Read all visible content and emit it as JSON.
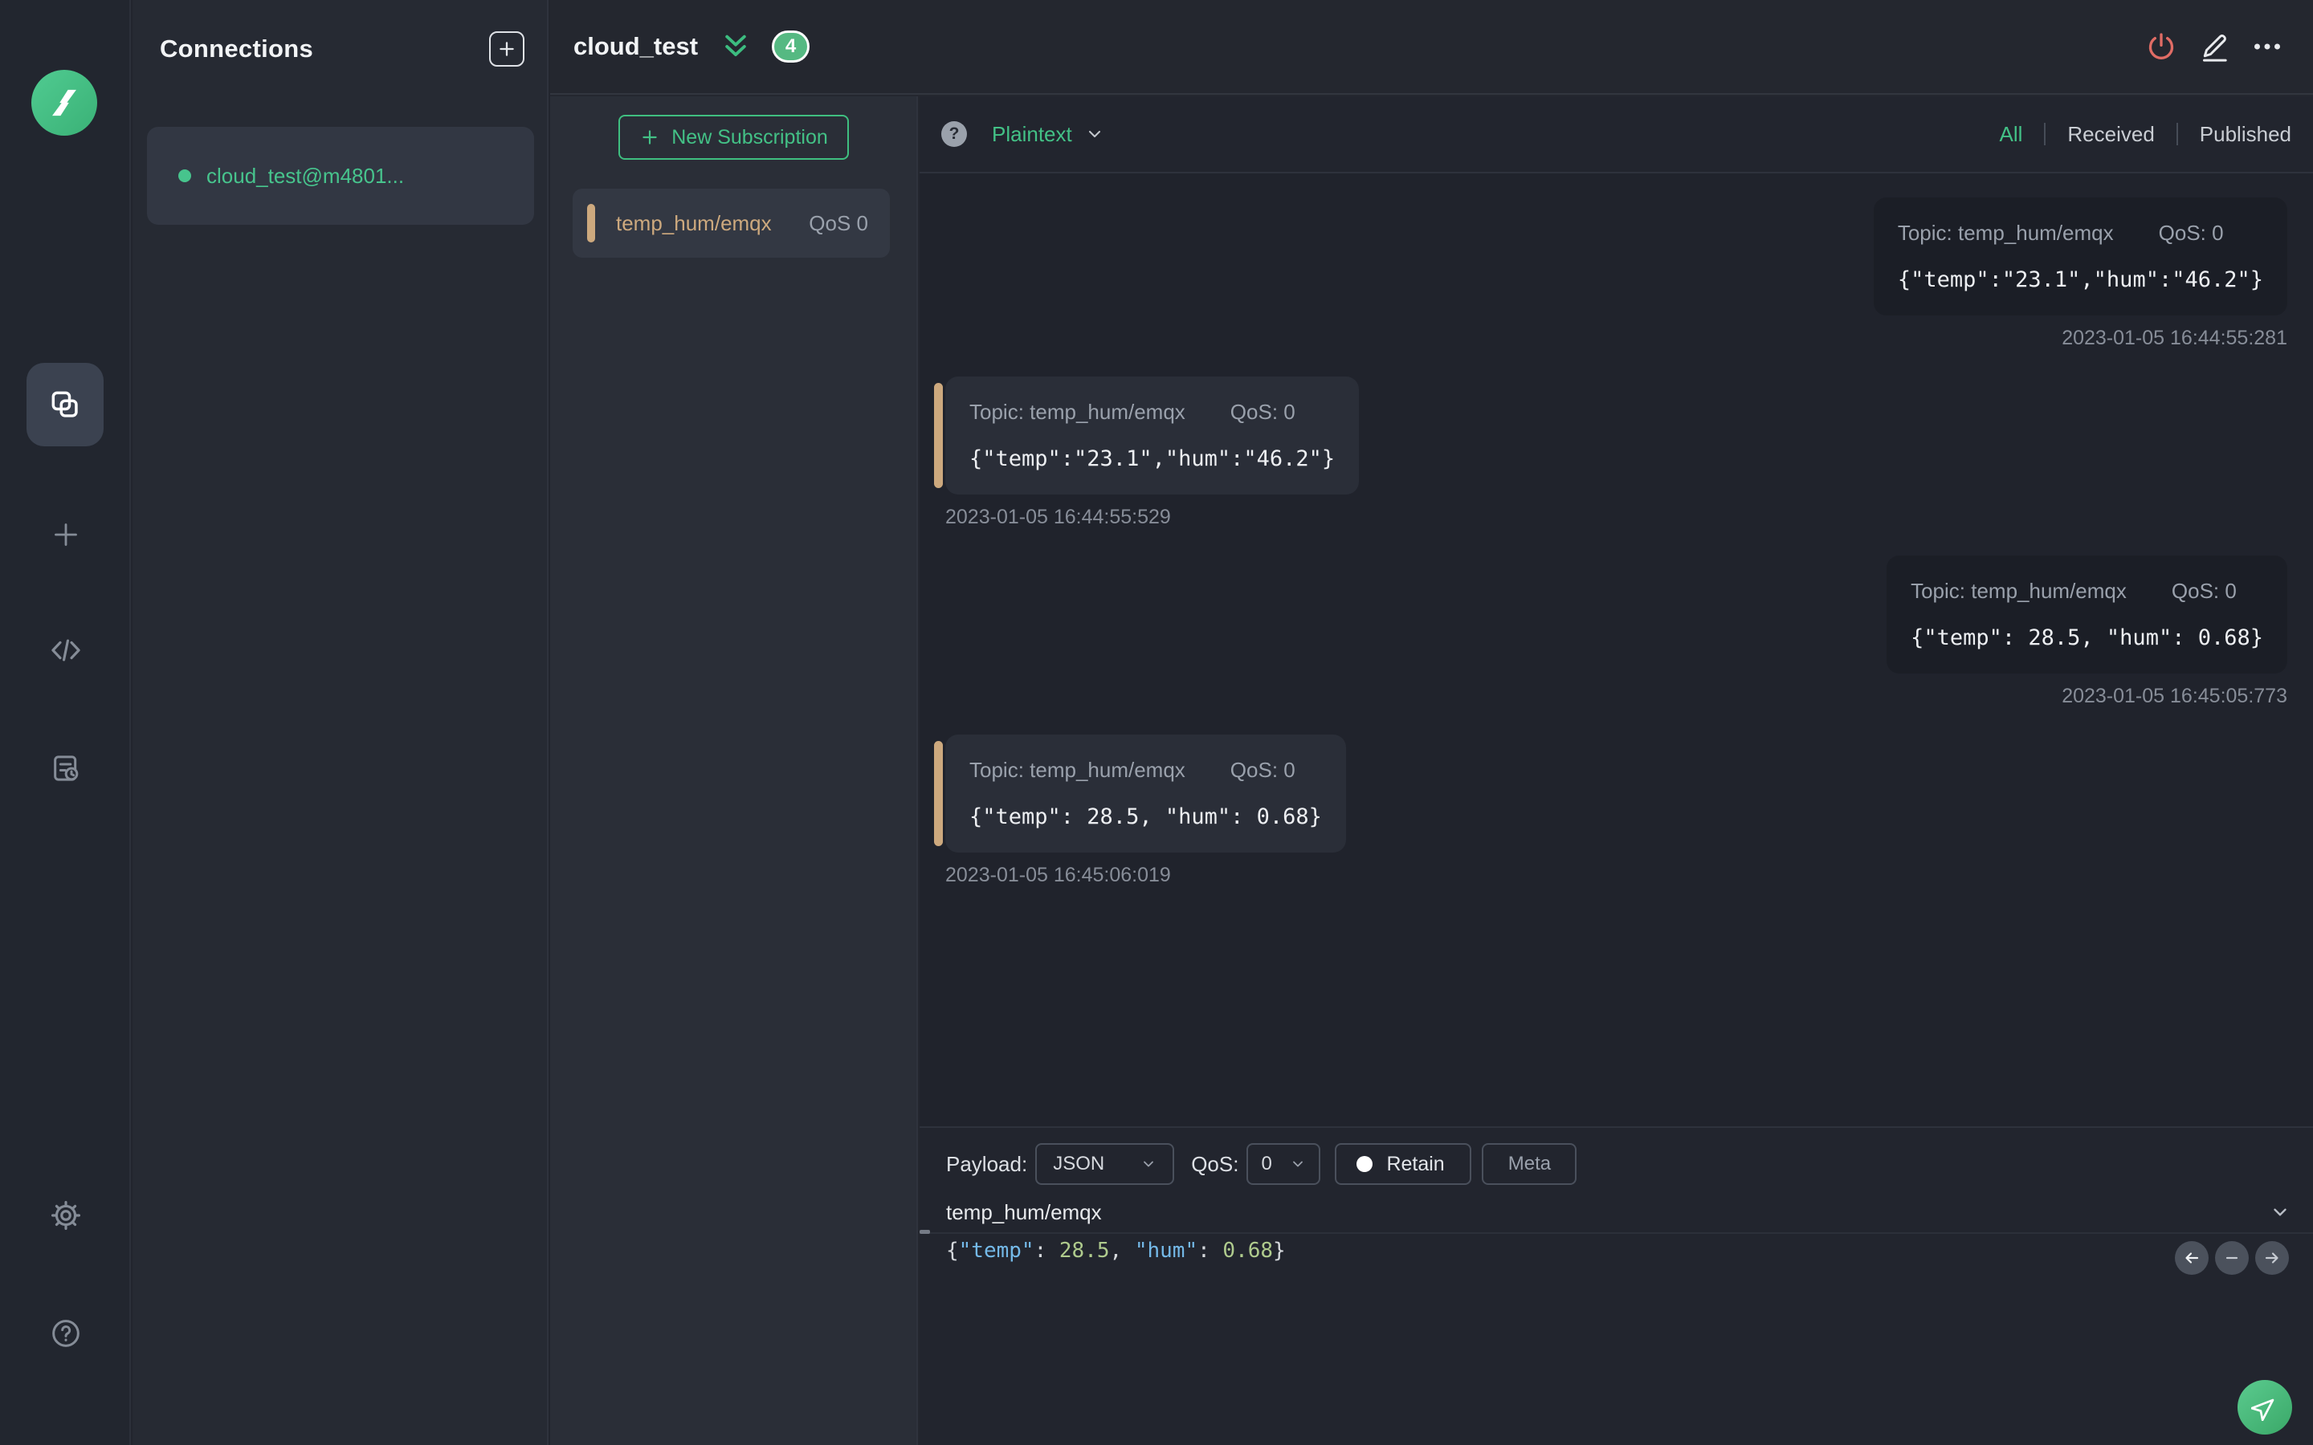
{
  "colors": {
    "accent_green": "#42c183",
    "tan_accent": "#cda97e",
    "danger_red": "#e06c65"
  },
  "sidebar": {
    "logo": "mqttx-logo",
    "nav_icons": [
      "connections",
      "new-connection",
      "script",
      "log"
    ],
    "footer_icons": [
      "settings",
      "help"
    ]
  },
  "connections": {
    "title": "Connections",
    "items": [
      {
        "name": "cloud_test@m4801...",
        "status": "connected"
      }
    ]
  },
  "header": {
    "title": "cloud_test",
    "badge_count": "4"
  },
  "subscriptions": {
    "new_button": "New Subscription",
    "items": [
      {
        "topic": "temp_hum/emqx",
        "qos": "QoS 0"
      }
    ]
  },
  "toolbar": {
    "help": "?",
    "format": "Plaintext",
    "filters": [
      "All",
      "Received",
      "Published"
    ],
    "active_filter": "All"
  },
  "messages": [
    {
      "direction": "published",
      "topic": "Topic: temp_hum/emqx",
      "qos": "QoS: 0",
      "payload": "{\"temp\":\"23.1\",\"hum\":\"46.2\"}",
      "timestamp": "2023-01-05 16:44:55:281"
    },
    {
      "direction": "received",
      "topic": "Topic: temp_hum/emqx",
      "qos": "QoS: 0",
      "payload": "{\"temp\":\"23.1\",\"hum\":\"46.2\"}",
      "timestamp": "2023-01-05 16:44:55:529"
    },
    {
      "direction": "published",
      "topic": "Topic: temp_hum/emqx",
      "qos": "QoS: 0",
      "payload": "{\"temp\": 28.5, \"hum\": 0.68}",
      "timestamp": "2023-01-05 16:45:05:773"
    },
    {
      "direction": "received",
      "topic": "Topic: temp_hum/emqx",
      "qos": "QoS: 0",
      "payload": "{\"temp\": 28.5, \"hum\": 0.68}",
      "timestamp": "2023-01-05 16:45:06:019"
    }
  ],
  "publish": {
    "payload_label": "Payload:",
    "payload_format": "JSON",
    "qos_label": "QoS:",
    "qos_value": "0",
    "retain_label": "Retain",
    "meta_label": "Meta",
    "topic": "temp_hum/emqx",
    "payload_tokens": [
      {
        "text": "{",
        "type": "punc"
      },
      {
        "text": "\"temp\"",
        "type": "key"
      },
      {
        "text": ": ",
        "type": "punc"
      },
      {
        "text": "28.5",
        "type": "num"
      },
      {
        "text": ", ",
        "type": "punc"
      },
      {
        "text": "\"hum\"",
        "type": "key"
      },
      {
        "text": ": ",
        "type": "punc"
      },
      {
        "text": "0.68",
        "type": "num"
      },
      {
        "text": "}",
        "type": "punc"
      }
    ]
  }
}
